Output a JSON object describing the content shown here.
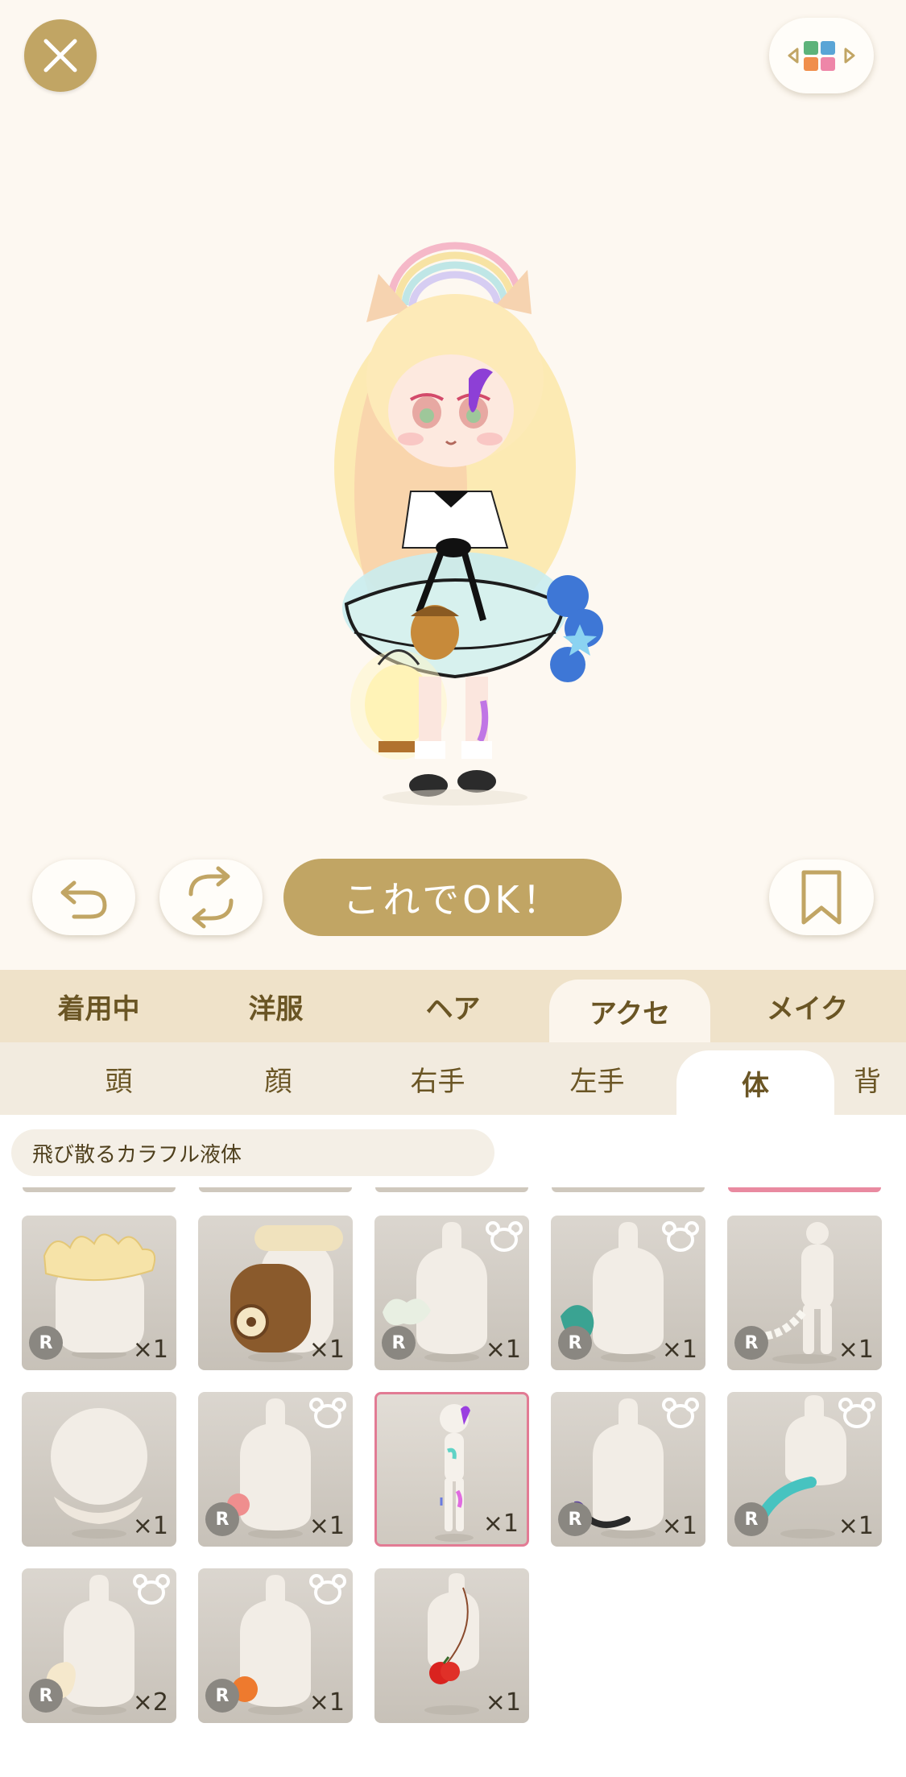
{
  "header": {
    "close_icon": "close-icon",
    "grid_icon": "color-grid-icon"
  },
  "actions": {
    "undo_icon": "undo-icon",
    "random_icon": "refresh-icon",
    "ok_label": "これでOK！",
    "bookmark_icon": "bookmark-icon"
  },
  "categories": {
    "tabs": [
      "着用中",
      "洋服",
      "ヘア",
      "アクセ",
      "メイク"
    ],
    "active": "アクセ"
  },
  "subcategories": {
    "tabs": [
      "頭",
      "顔",
      "右手",
      "左手",
      "体",
      "背"
    ],
    "active": "体"
  },
  "selected_item_name": "飛び散るカラフル液体",
  "items": [
    {
      "variant": "frill",
      "rare": true,
      "qty": "×1",
      "bear": false
    },
    {
      "variant": "backpack",
      "rare": false,
      "qty": "×1",
      "bear": false
    },
    {
      "variant": "smoke",
      "rare": true,
      "qty": "×1",
      "bear": true
    },
    {
      "variant": "feather",
      "rare": true,
      "qty": "×1",
      "bear": true
    },
    {
      "variant": "tail-bone",
      "rare": true,
      "qty": "×1",
      "bear": false
    },
    {
      "variant": "head",
      "rare": false,
      "qty": "×1",
      "bear": false
    },
    {
      "variant": "pink-blob",
      "rare": true,
      "qty": "×1",
      "bear": true
    },
    {
      "variant": "liquid-figure",
      "rare": false,
      "qty": "×1",
      "bear": false,
      "selected": true
    },
    {
      "variant": "dark-tail",
      "rare": true,
      "qty": "×1",
      "bear": true
    },
    {
      "variant": "teal-tail",
      "rare": true,
      "qty": "×1",
      "bear": true
    },
    {
      "variant": "cream-puff",
      "rare": true,
      "qty": "×2",
      "bear": true
    },
    {
      "variant": "orange-ball",
      "rare": true,
      "qty": "×1",
      "bear": true
    },
    {
      "variant": "cherry-bag",
      "rare": false,
      "qty": "×1",
      "bear": false
    }
  ],
  "rare_badge": "R",
  "colors": {
    "accent": "#c1a564",
    "background": "#fdf8f1",
    "selected_border": "#e27b94",
    "tab_bar": "#efe2c9"
  }
}
